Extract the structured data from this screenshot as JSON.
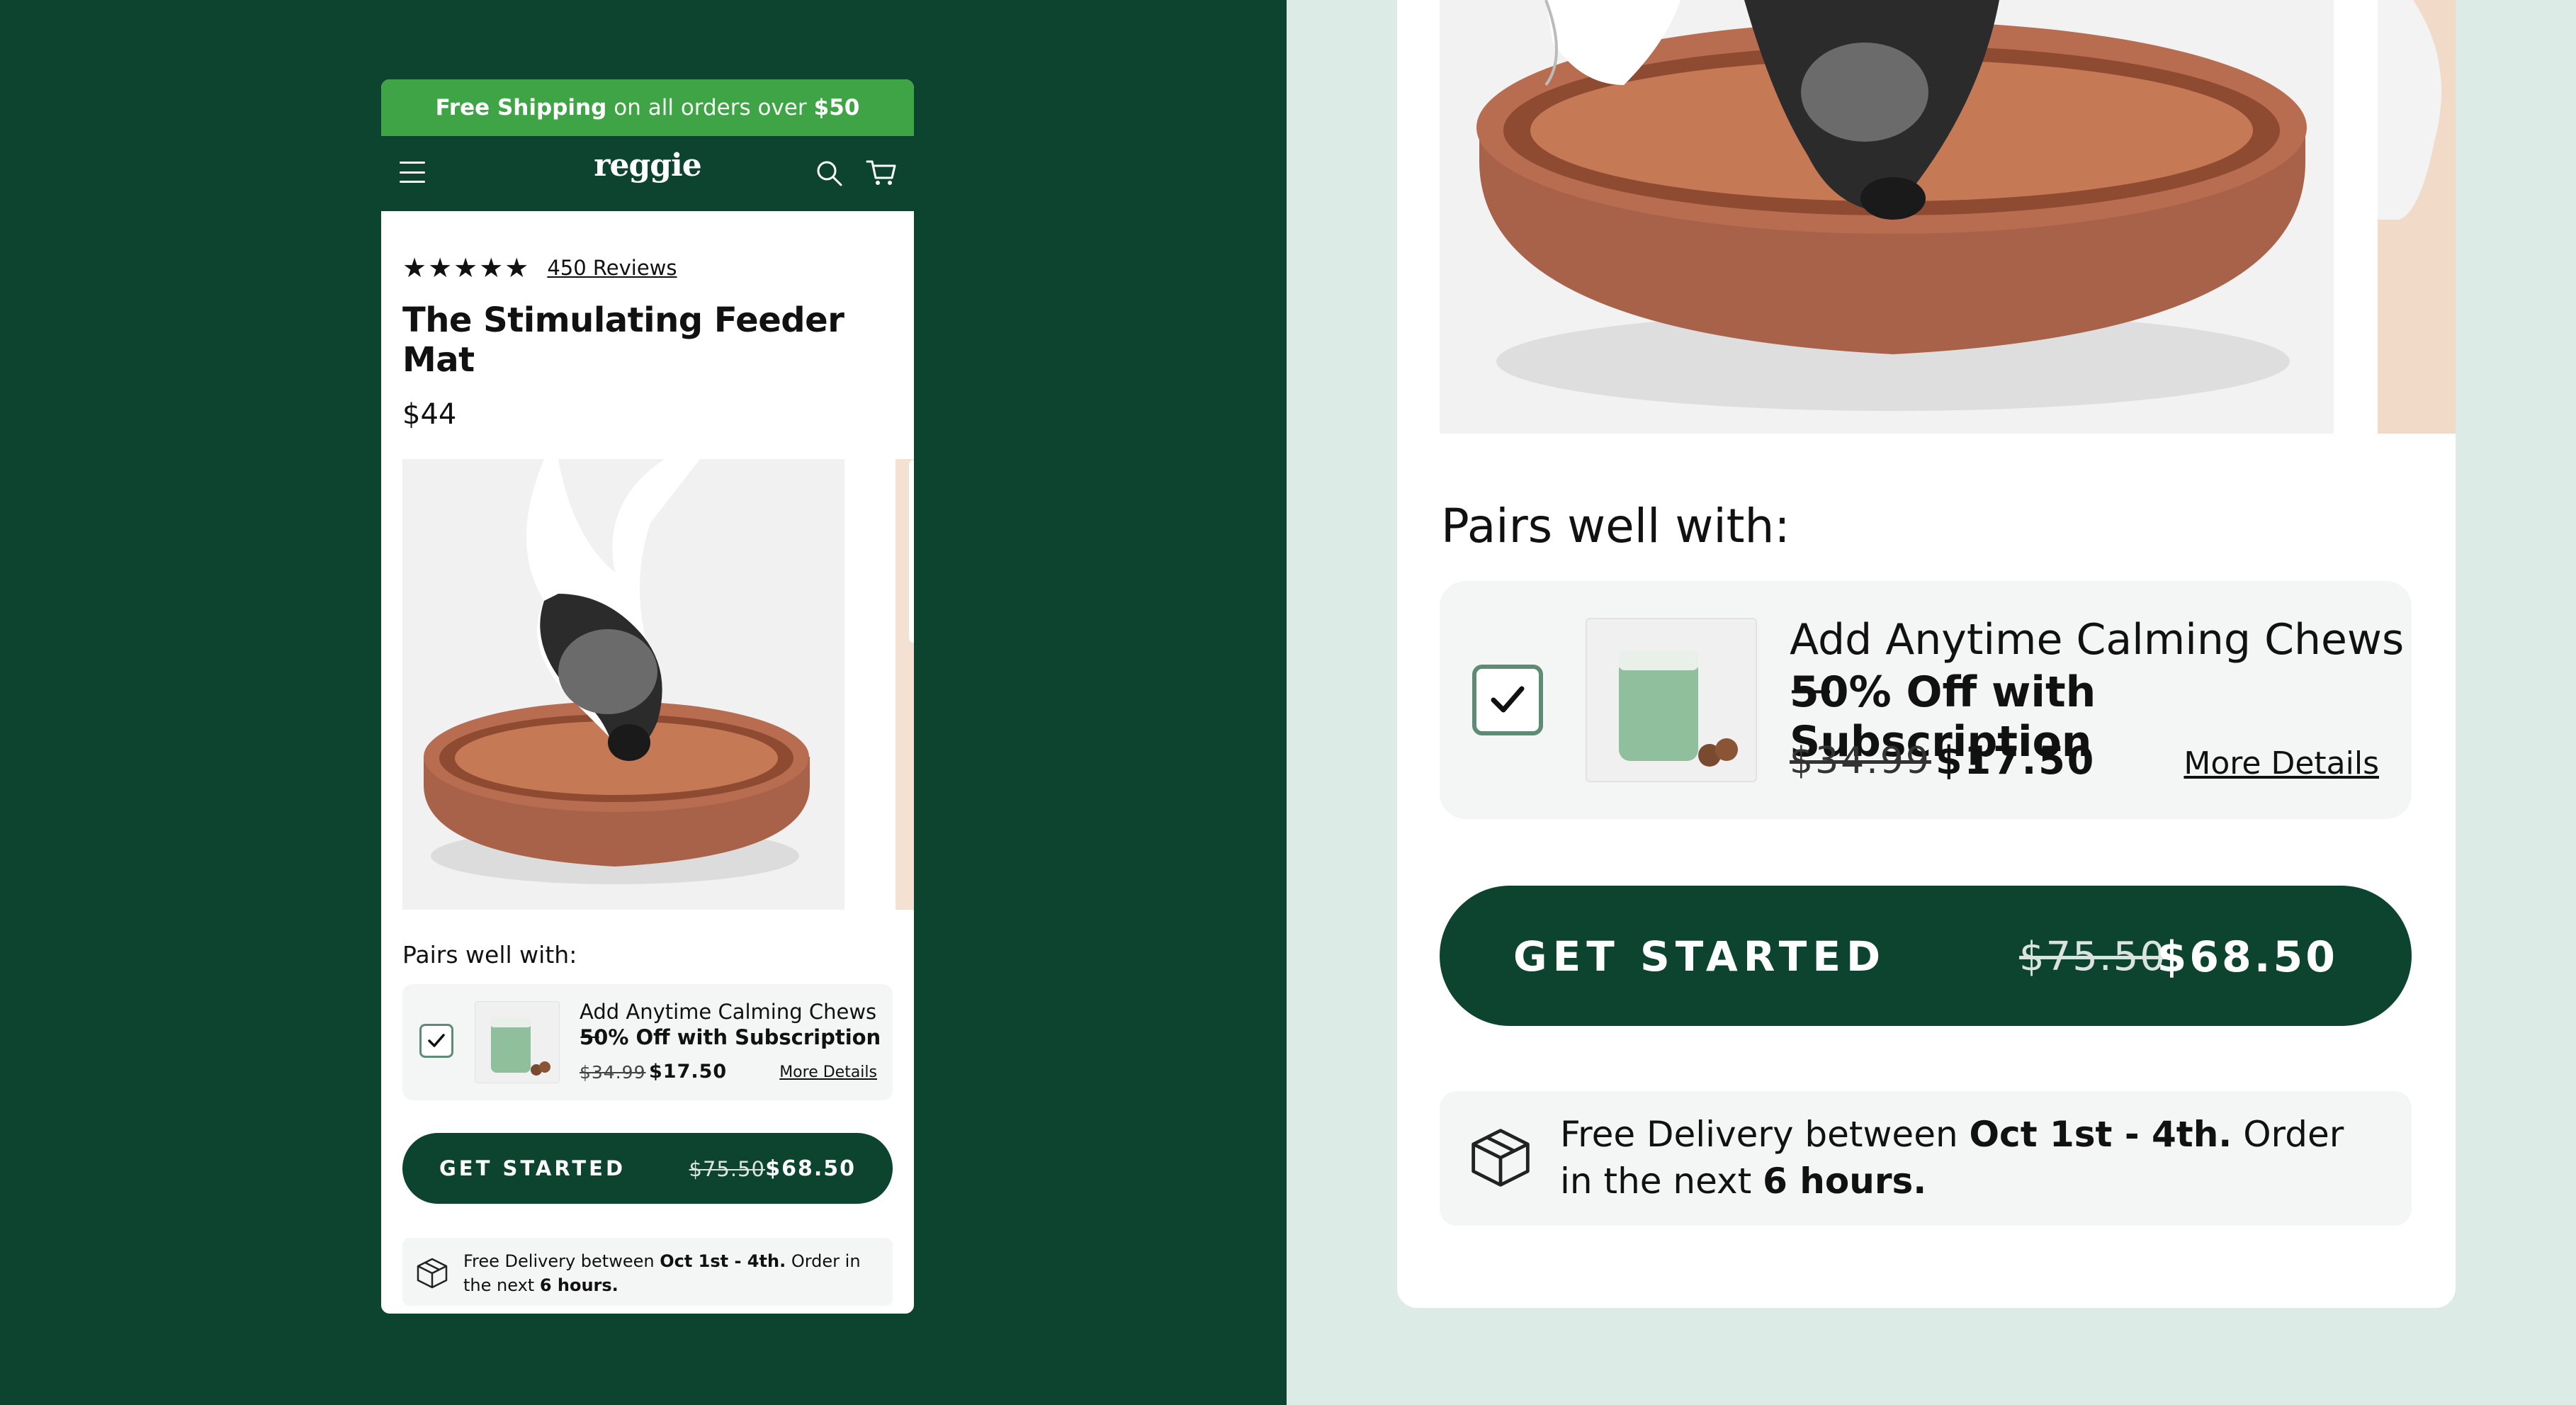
{
  "promo": {
    "part1": "Free Shipping",
    "part2": "on all orders over",
    "part3": "$50"
  },
  "nav": {
    "logo": "reggie"
  },
  "product": {
    "stars": "★★★★★",
    "reviews": "450 Reviews",
    "title": "The Stimulating Feeder Mat",
    "price": "$44"
  },
  "pairs": {
    "heading": "Pairs well with:",
    "addon_line1": "Add Anytime Calming Chews —",
    "addon_line2": "50% Off with Subscription",
    "old_price": "$34.99",
    "new_price": "$17.50",
    "more_link": "More Details",
    "checked": true
  },
  "cta": {
    "label": "GET STARTED",
    "old_price": "$75.50",
    "new_price": "$68.50"
  },
  "delivery": {
    "t1": "Free Delivery between ",
    "t2": "Oct 1st - 4th.",
    "t3": " Order in the next ",
    "t4": "6 hours."
  },
  "colors": {
    "brand_green": "#0c4430",
    "promo_green": "#3fa445",
    "mint": "#dcebe5",
    "mat_brown": "#a9624a"
  }
}
